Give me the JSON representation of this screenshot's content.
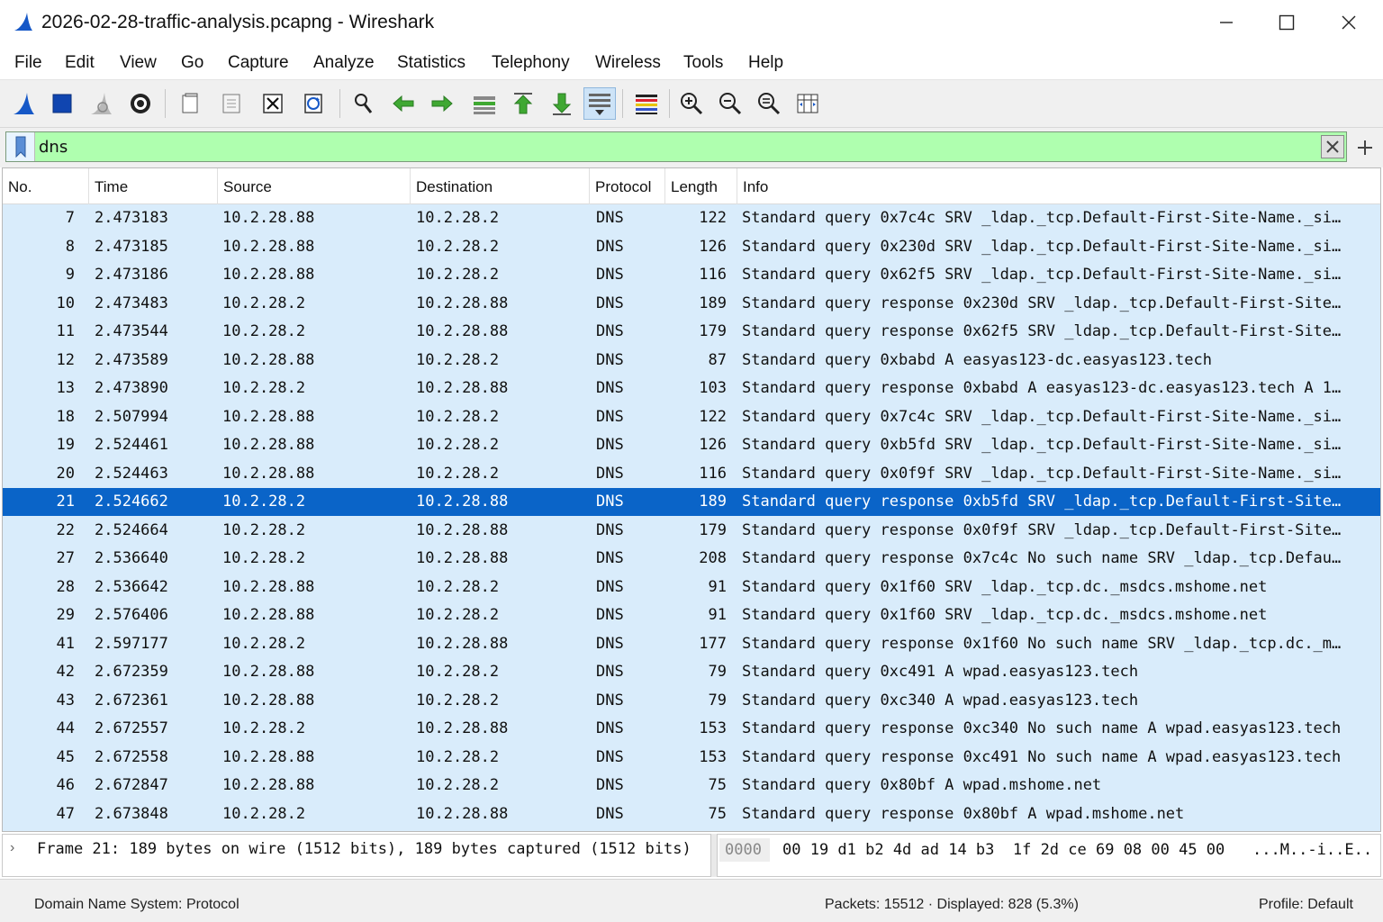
{
  "window": {
    "title": "2026-02-28-traffic-analysis.pcapng - Wireshark",
    "minimize_glyph": "—",
    "maximize_glyph": "☐",
    "close_glyph": "✕"
  },
  "menu": [
    "File",
    "Edit",
    "View",
    "Go",
    "Capture",
    "Analyze",
    "Statistics",
    "Telephony",
    "Wireless",
    "Tools",
    "Help"
  ],
  "toolbar": {
    "icons": [
      "start-capture-icon",
      "stop-capture-icon",
      "restart-capture-icon",
      "capture-options-icon",
      "open-file-icon",
      "save-file-icon",
      "close-file-icon",
      "reload-file-icon",
      "find-packet-icon",
      "go-back-icon",
      "go-forward-icon",
      "go-to-packet-icon",
      "go-first-packet-icon",
      "go-last-packet-icon",
      "auto-scroll-icon",
      "colorize-icon",
      "zoom-in-icon",
      "zoom-out-icon",
      "normal-size-icon",
      "resize-columns-icon"
    ]
  },
  "filter": {
    "value": "dns",
    "background_color": "#afffaf"
  },
  "columns": [
    "No.",
    "Time",
    "Source",
    "Destination",
    "Protocol",
    "Length",
    "Info"
  ],
  "packets": [
    {
      "no": "7",
      "time": "2.473183",
      "src": "10.2.28.88",
      "dst": "10.2.28.2",
      "proto": "DNS",
      "len": "122",
      "info": "Standard query 0x7c4c  SRV  _ldap._tcp.Default-First-Site-Name._si…"
    },
    {
      "no": "8",
      "time": "2.473185",
      "src": "10.2.28.88",
      "dst": "10.2.28.2",
      "proto": "DNS",
      "len": "126",
      "info": "Standard query 0x230d  SRV  _ldap._tcp.Default-First-Site-Name._si…"
    },
    {
      "no": "9",
      "time": "2.473186",
      "src": "10.2.28.88",
      "dst": "10.2.28.2",
      "proto": "DNS",
      "len": "116",
      "info": "Standard query 0x62f5  SRV  _ldap._tcp.Default-First-Site-Name._si…"
    },
    {
      "no": "10",
      "time": "2.473483",
      "src": "10.2.28.2",
      "dst": "10.2.28.88",
      "proto": "DNS",
      "len": "189",
      "info": "Standard query response 0x230d  SRV  _ldap._tcp.Default-First-Site…"
    },
    {
      "no": "11",
      "time": "2.473544",
      "src": "10.2.28.2",
      "dst": "10.2.28.88",
      "proto": "DNS",
      "len": "179",
      "info": "Standard query response 0x62f5  SRV  _ldap._tcp.Default-First-Site…"
    },
    {
      "no": "12",
      "time": "2.473589",
      "src": "10.2.28.88",
      "dst": "10.2.28.2",
      "proto": "DNS",
      "len": "87",
      "info": "Standard query 0xbabd  A  easyas123-dc.easyas123.tech"
    },
    {
      "no": "13",
      "time": "2.473890",
      "src": "10.2.28.2",
      "dst": "10.2.28.88",
      "proto": "DNS",
      "len": "103",
      "info": "Standard query response 0xbabd  A  easyas123-dc.easyas123.tech A 1…"
    },
    {
      "no": "18",
      "time": "2.507994",
      "src": "10.2.28.88",
      "dst": "10.2.28.2",
      "proto": "DNS",
      "len": "122",
      "info": "Standard query 0x7c4c  SRV  _ldap._tcp.Default-First-Site-Name._si…"
    },
    {
      "no": "19",
      "time": "2.524461",
      "src": "10.2.28.88",
      "dst": "10.2.28.2",
      "proto": "DNS",
      "len": "126",
      "info": "Standard query 0xb5fd  SRV  _ldap._tcp.Default-First-Site-Name._si…"
    },
    {
      "no": "20",
      "time": "2.524463",
      "src": "10.2.28.88",
      "dst": "10.2.28.2",
      "proto": "DNS",
      "len": "116",
      "info": "Standard query 0x0f9f  SRV  _ldap._tcp.Default-First-Site-Name._si…"
    },
    {
      "no": "21",
      "time": "2.524662",
      "src": "10.2.28.2",
      "dst": "10.2.28.88",
      "proto": "DNS",
      "len": "189",
      "info": "Standard query response 0xb5fd  SRV  _ldap._tcp.Default-First-Site…",
      "selected": true
    },
    {
      "no": "22",
      "time": "2.524664",
      "src": "10.2.28.2",
      "dst": "10.2.28.88",
      "proto": "DNS",
      "len": "179",
      "info": "Standard query response 0x0f9f  SRV  _ldap._tcp.Default-First-Site…"
    },
    {
      "no": "27",
      "time": "2.536640",
      "src": "10.2.28.2",
      "dst": "10.2.28.88",
      "proto": "DNS",
      "len": "208",
      "info": "Standard query response 0x7c4c  No such name  SRV  _ldap._tcp.Defau…"
    },
    {
      "no": "28",
      "time": "2.536642",
      "src": "10.2.28.88",
      "dst": "10.2.28.2",
      "proto": "DNS",
      "len": "91",
      "info": "Standard query 0x1f60  SRV  _ldap._tcp.dc._msdcs.mshome.net"
    },
    {
      "no": "29",
      "time": "2.576406",
      "src": "10.2.28.88",
      "dst": "10.2.28.2",
      "proto": "DNS",
      "len": "91",
      "info": "Standard query 0x1f60  SRV  _ldap._tcp.dc._msdcs.mshome.net"
    },
    {
      "no": "41",
      "time": "2.597177",
      "src": "10.2.28.2",
      "dst": "10.2.28.88",
      "proto": "DNS",
      "len": "177",
      "info": "Standard query response 0x1f60  No such name  SRV  _ldap._tcp.dc._m…"
    },
    {
      "no": "42",
      "time": "2.672359",
      "src": "10.2.28.88",
      "dst": "10.2.28.2",
      "proto": "DNS",
      "len": "79",
      "info": "Standard query 0xc491  A  wpad.easyas123.tech"
    },
    {
      "no": "43",
      "time": "2.672361",
      "src": "10.2.28.88",
      "dst": "10.2.28.2",
      "proto": "DNS",
      "len": "79",
      "info": "Standard query 0xc340  A  wpad.easyas123.tech"
    },
    {
      "no": "44",
      "time": "2.672557",
      "src": "10.2.28.2",
      "dst": "10.2.28.88",
      "proto": "DNS",
      "len": "153",
      "info": "Standard query response 0xc340  No such name  A  wpad.easyas123.tech"
    },
    {
      "no": "45",
      "time": "2.672558",
      "src": "10.2.28.88",
      "dst": "10.2.28.2",
      "proto": "DNS",
      "len": "153",
      "info": "Standard query response 0xc491  No such name  A  wpad.easyas123.tech"
    },
    {
      "no": "46",
      "time": "2.672847",
      "src": "10.2.28.88",
      "dst": "10.2.28.2",
      "proto": "DNS",
      "len": "75",
      "info": "Standard query 0x80bf  A  wpad.mshome.net"
    },
    {
      "no": "47",
      "time": "2.673848",
      "src": "10.2.28.2",
      "dst": "10.2.28.88",
      "proto": "DNS",
      "len": "75",
      "info": "Standard query response 0x80bf  A  wpad.mshome.net"
    }
  ],
  "colors": {
    "row_background": "#d9ecfb",
    "selected_row": "#0a64c8"
  },
  "details": {
    "expand_glyph": "›",
    "frame_summary": "Frame 21: 189 bytes on wire (1512 bits), 189 bytes captured (1512 bits)"
  },
  "bytes": {
    "offset": "0000",
    "hex": "00 19 d1 b2 4d ad 14 b3  1f 2d ce 69 08 00 45 00",
    "ascii": "...M..-i..E.."
  },
  "status": {
    "field": "Domain Name System: Protocol",
    "packets": "Packets: 15512 · Displayed: 828 (5.3%)",
    "profile": "Profile: Default"
  }
}
